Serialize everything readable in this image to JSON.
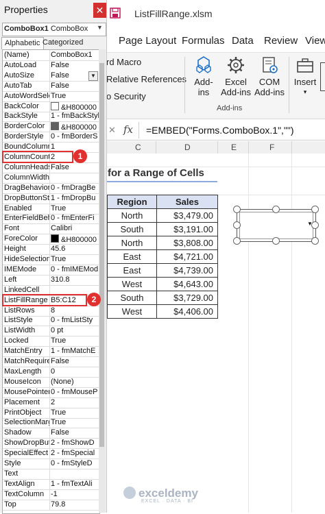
{
  "properties": {
    "title": "Properties",
    "close_glyph": "✕",
    "object_name": "ComboBox1",
    "object_type": "ComboBox",
    "tabs": [
      "Alphabetic",
      "Categorized"
    ],
    "rows": [
      {
        "name": "(Name)",
        "value": "ComboBox1"
      },
      {
        "name": "AutoLoad",
        "value": "False"
      },
      {
        "name": "AutoSize",
        "value": "False",
        "dropdown": true
      },
      {
        "name": "AutoTab",
        "value": "False"
      },
      {
        "name": "AutoWordSelect",
        "value": "True"
      },
      {
        "name": "BackColor",
        "value": "&H800000",
        "swatch": "#ffffff"
      },
      {
        "name": "BackStyle",
        "value": "1 - fmBackStyle"
      },
      {
        "name": "BorderColor",
        "value": "&H800000",
        "swatch": "#606060"
      },
      {
        "name": "BorderStyle",
        "value": "0 - fmBorderS"
      },
      {
        "name": "BoundColumn",
        "value": "1"
      },
      {
        "name": "ColumnCount",
        "value": "2"
      },
      {
        "name": "ColumnHeads",
        "value": "False"
      },
      {
        "name": "ColumnWidths",
        "value": ""
      },
      {
        "name": "DragBehavior",
        "value": "0 - fmDragBe"
      },
      {
        "name": "DropButtonStyle",
        "value": "1 - fmDropBu"
      },
      {
        "name": "Enabled",
        "value": "True"
      },
      {
        "name": "EnterFieldBehavior",
        "value": "0 - fmEnterFi"
      },
      {
        "name": "Font",
        "value": "Calibri"
      },
      {
        "name": "ForeColor",
        "value": "&H800000",
        "swatch": "#000000"
      },
      {
        "name": "Height",
        "value": "45.6"
      },
      {
        "name": "HideSelection",
        "value": "True"
      },
      {
        "name": "IMEMode",
        "value": "0 - fmIMEMod"
      },
      {
        "name": "Left",
        "value": "310.8"
      },
      {
        "name": "LinkedCell",
        "value": ""
      },
      {
        "name": "ListFillRange",
        "value": "B5:C12"
      },
      {
        "name": "ListRows",
        "value": "8"
      },
      {
        "name": "ListStyle",
        "value": "0 - fmListSty"
      },
      {
        "name": "ListWidth",
        "value": "0 pt"
      },
      {
        "name": "Locked",
        "value": "True"
      },
      {
        "name": "MatchEntry",
        "value": "1 - fmMatchE"
      },
      {
        "name": "MatchRequired",
        "value": "False"
      },
      {
        "name": "MaxLength",
        "value": "0"
      },
      {
        "name": "MouseIcon",
        "value": "(None)"
      },
      {
        "name": "MousePointer",
        "value": "0 - fmMouseP"
      },
      {
        "name": "Placement",
        "value": "2"
      },
      {
        "name": "PrintObject",
        "value": "True"
      },
      {
        "name": "SelectionMargin",
        "value": "True"
      },
      {
        "name": "Shadow",
        "value": "False"
      },
      {
        "name": "ShowDropButtonWhen",
        "value": "2 - fmShowD"
      },
      {
        "name": "SpecialEffect",
        "value": "2 - fmSpecial"
      },
      {
        "name": "Style",
        "value": "0 - fmStyleD"
      },
      {
        "name": "Text",
        "value": ""
      },
      {
        "name": "TextAlign",
        "value": "1 - fmTextAli"
      },
      {
        "name": "TextColumn",
        "value": "-1"
      },
      {
        "name": "Top",
        "value": "79.8"
      }
    ],
    "annotations": [
      {
        "label": "1",
        "target": "ColumnCount"
      },
      {
        "label": "2",
        "target": "ListFillRange"
      }
    ]
  },
  "excel": {
    "file_title": "ListFillRange.xlsm",
    "tabs": [
      "Page Layout",
      "Formulas",
      "Data",
      "Review",
      "View"
    ],
    "ribbon_small": [
      "rd Macro",
      "Relative References",
      "o Security"
    ],
    "ribbon_big": [
      {
        "label": "Add-\nins",
        "icon": "add-ins-icon"
      },
      {
        "label": "Excel\nAdd-ins",
        "icon": "gear-icon"
      },
      {
        "label": "COM\nAdd-ins",
        "icon": "com-add-ins-icon"
      },
      {
        "label": "Insert",
        "icon": "toolbox-icon"
      }
    ],
    "group_label": "Add-ins",
    "formula": {
      "cancel": "✕",
      "enter": "✓",
      "fx": "fx",
      "text": "=EMBED(\"Forms.ComboBox.1\",\"\")"
    },
    "columns": [
      "C",
      "D",
      "E",
      "F"
    ],
    "sheet_title": "for a Range of Cells",
    "table": {
      "headers": [
        "Region",
        "Sales"
      ],
      "rows": [
        [
          "North",
          "$3,479.00"
        ],
        [
          "South",
          "$3,191.00"
        ],
        [
          "North",
          "$3,808.00"
        ],
        [
          "East",
          "$4,721.00"
        ],
        [
          "East",
          "$4,739.00"
        ],
        [
          "West",
          "$4,643.00"
        ],
        [
          "South",
          "$3,729.00"
        ],
        [
          "West",
          "$4,406.00"
        ]
      ]
    }
  },
  "watermark": {
    "name": "exceldemy",
    "tagline": "EXCEL · DATA · BI"
  },
  "colors": {
    "accent_red": "#e03030",
    "header_fill": "#d9e1f2",
    "close_red": "#d32f2f"
  }
}
